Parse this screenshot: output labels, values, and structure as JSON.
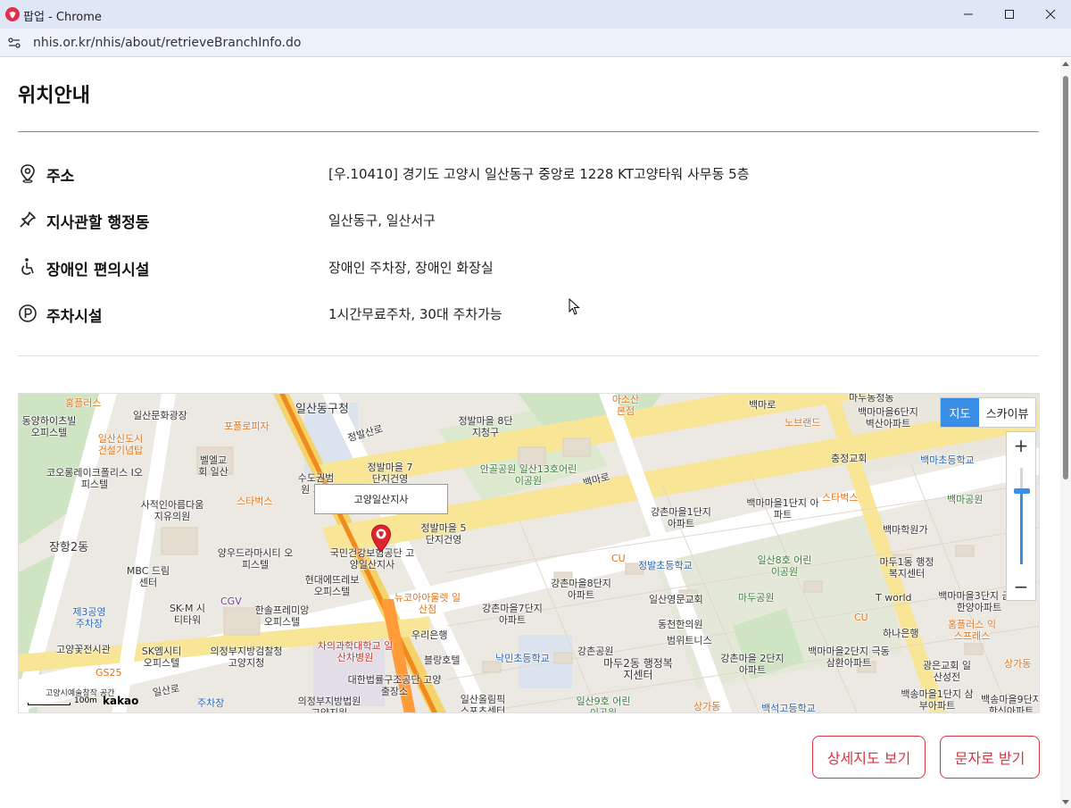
{
  "window": {
    "title": "팝업 - Chrome",
    "url": "nhis.or.kr/nhis/about/retrieveBranchInfo.do"
  },
  "page": {
    "heading": "위치안내",
    "info": [
      {
        "label": "주소",
        "value": "[우.10410] 경기도 고양시 일산동구 중앙로 1228 KT고양타워 사무동 5층",
        "icon": "location-pin-icon"
      },
      {
        "label": "지사관할 행정동",
        "value": "일산동구, 일산서구",
        "icon": "pushpin-icon"
      },
      {
        "label": "장애인 편의시설",
        "value": "장애인 주차장, 장애인 화장실",
        "icon": "wheelchair-icon"
      },
      {
        "label": "주차시설",
        "value": "1시간무료주차, 30대 주차가능",
        "icon": "parking-icon"
      }
    ]
  },
  "map": {
    "marker_label": "고양일산지사",
    "type_map": "지도",
    "type_sky": "스카이뷰",
    "zoom_in": "+",
    "zoom_out": "−",
    "scale": "100m",
    "attribution": "kakao",
    "labels": [
      "홍플러스",
      "일산문화광장",
      "일산동구청",
      "정발마을 8단지청구",
      "아소산 본점",
      "마두동정동",
      "백마마을6단지 벽산아파트",
      "백마로",
      "동양하이츠빌 오피스텔",
      "일산신도시 건설기념탑",
      "포플로피자",
      "정발산로",
      "노브랜드",
      "충정교회",
      "백마초등학교",
      "벨엘교회 일산",
      "코오롱레이크폴리스 I오피스텔",
      "수도권범원 기록",
      "정발마을 7단지건영",
      "안골공원 일산13호어린이공원",
      "백마로",
      "사적인아름다움 지유의원",
      "스타벅스",
      "정발마을 5단지건영",
      "강촌마을1단지 아파트",
      "백마마을1단지 아파트",
      "스타벅스",
      "백마공원",
      "장항2동",
      "양우드라마시티 오피스텔",
      "국민건강보험공단 고양일산지사",
      "백마학원가",
      "CU",
      "정발초등학교",
      "일산8호 어린이공원",
      "마두1동 행정복지센터",
      "MBC 드림센터",
      "CGV",
      "현대에뜨레보 오피스텔",
      "뉴코아아울렛 일산점",
      "강촌마을8단지 아파트",
      "일산영문교회",
      "마두공원",
      "T world",
      "백마마을3단지 금호한양아파트",
      "제3공영 주차장",
      "SK-M 시티타워",
      "한솔프레미앙 오피스텔",
      "강촌마을7단지 아파트",
      "동천한의원",
      "CU",
      "하나은행",
      "홈플러스 익스프레스",
      "고양꽃전시관",
      "SK엠시티 오피스텔",
      "의정부지방검찰청 고양지청",
      "차의과학대학교 일산차병원",
      "우리은행",
      "범위트니스",
      "백마마을2단지 극동삼환아파트",
      "상가동",
      "GS25",
      "블랑호텔",
      "낙민초등학교",
      "강촌공원",
      "마두2동 행정복지센터",
      "강촌마을 2단지아파트",
      "광은교회 일산성전",
      "고양시예술창작 공간",
      "주차장",
      "의정부지방법원 고양지원",
      "대한법률구조공단 고양출장소",
      "일산올림픽 스포츠센터",
      "일산9호 어린이공원",
      "상가동",
      "백석고등학교",
      "백송마을1단지 삼부아파트",
      "백송마을9단지 한신아파트",
      "일산로"
    ]
  },
  "buttons": {
    "detail_map": "상세지도 보기",
    "sms": "문자로 받기"
  }
}
